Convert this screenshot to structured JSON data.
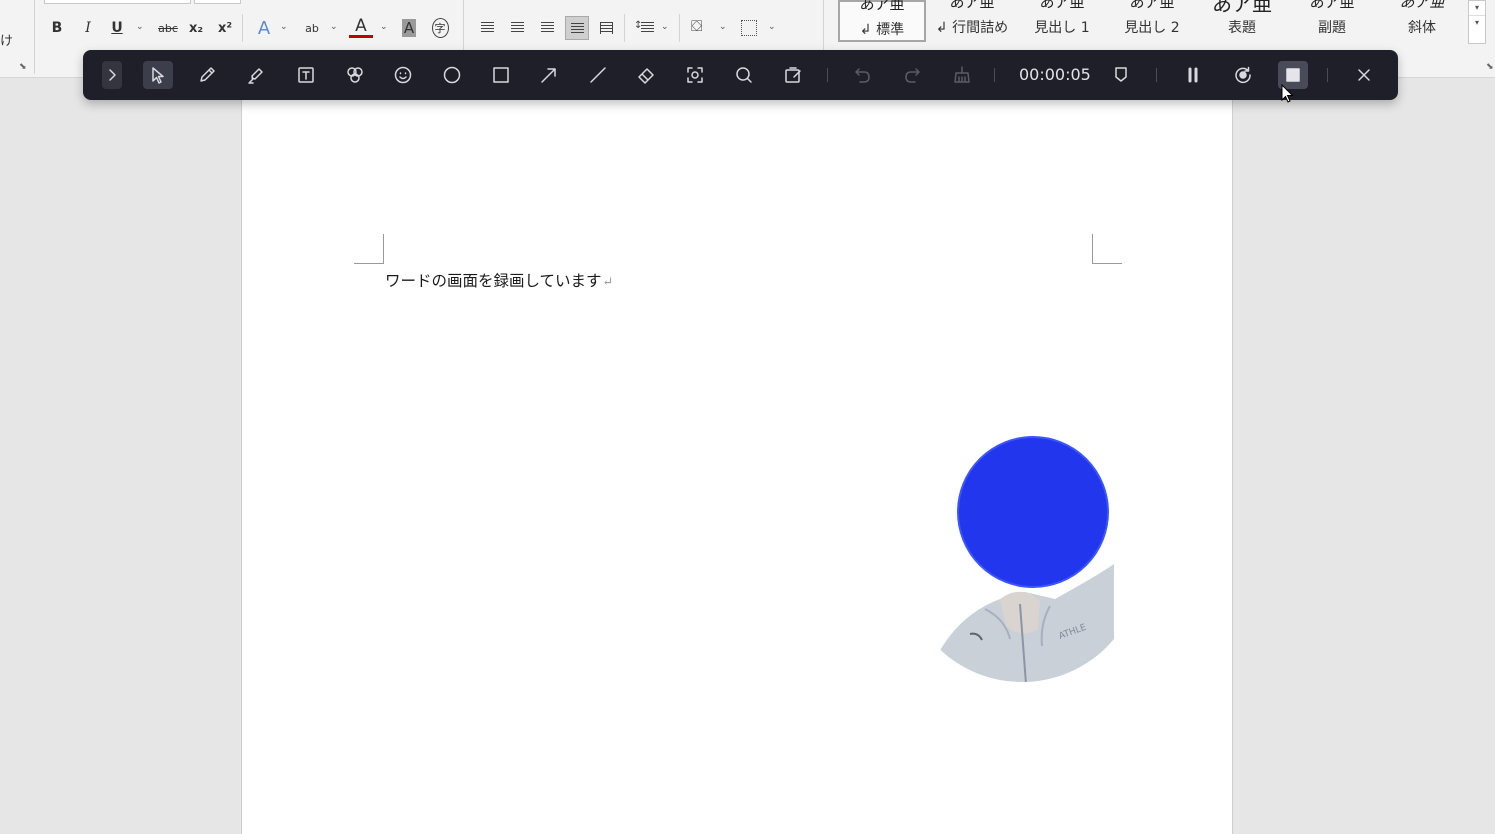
{
  "ribbon": {
    "cut_label": "け",
    "font_buttons": [
      {
        "name": "bold-button",
        "icon": "bold-icon",
        "glyph": "B"
      },
      {
        "name": "italic-button",
        "icon": "italic-icon",
        "glyph": "I"
      },
      {
        "name": "underline-button",
        "icon": "underline-icon",
        "glyph": "U"
      },
      {
        "name": "strikethrough-button",
        "icon": "strikethrough-icon",
        "glyph": "abc"
      },
      {
        "name": "subscript-button",
        "icon": "subscript-icon",
        "glyph": "x₂"
      },
      {
        "name": "superscript-button",
        "icon": "superscript-icon",
        "glyph": "x²"
      },
      {
        "name": "text-effects-button",
        "icon": "text-effects-icon",
        "glyph": "A"
      },
      {
        "name": "highlight-button",
        "icon": "highlighter-icon",
        "glyph": "ab"
      },
      {
        "name": "font-color-button",
        "icon": "font-color-icon",
        "glyph": "A"
      },
      {
        "name": "char-shading-button",
        "icon": "char-shading-icon",
        "glyph": "A"
      },
      {
        "name": "enclose-char-button",
        "icon": "enclose-char-icon",
        "glyph": "字"
      }
    ],
    "font_color_hex": "#c00000",
    "styles_gallery": {
      "items": [
        {
          "preview": "あア亜",
          "label": "↲ 標準",
          "selected": true
        },
        {
          "preview": "あア亜",
          "label": "↲ 行間詰め",
          "selected": false
        },
        {
          "preview": "あア亜",
          "label": "見出し 1",
          "selected": false
        },
        {
          "preview": "あア亜",
          "label": "見出し 2",
          "selected": false
        },
        {
          "preview": "あア亜",
          "label": "表題",
          "selected": false
        },
        {
          "preview": "あア亜",
          "label": "副題",
          "selected": false
        },
        {
          "preview": "あア亜",
          "label": "斜体",
          "selected": false
        }
      ]
    }
  },
  "document": {
    "text": "ワードの画面を録画しています",
    "paragraph_mark": "↵"
  },
  "recorder": {
    "timer": "00:00:05",
    "tools": [
      {
        "name": "collapse-button",
        "icon": "chevron-right-icon"
      },
      {
        "name": "select-tool",
        "icon": "cursor-arrow-icon",
        "active": true
      },
      {
        "name": "pen-tool",
        "icon": "pencil-icon"
      },
      {
        "name": "highlighter-tool",
        "icon": "highlighter-icon"
      },
      {
        "name": "text-tool",
        "icon": "text-box-icon"
      },
      {
        "name": "numbered-marker-tool",
        "icon": "numbered-marker-icon"
      },
      {
        "name": "emoji-tool",
        "icon": "smiley-icon"
      },
      {
        "name": "ellipse-tool",
        "icon": "circle-icon"
      },
      {
        "name": "rectangle-tool",
        "icon": "square-icon"
      },
      {
        "name": "arrow-tool",
        "icon": "arrow-icon"
      },
      {
        "name": "line-tool",
        "icon": "line-icon"
      },
      {
        "name": "eraser-tool",
        "icon": "eraser-icon"
      },
      {
        "name": "spotlight-tool",
        "icon": "focus-icon"
      },
      {
        "name": "zoom-tool",
        "icon": "magnifier-icon"
      },
      {
        "name": "whiteboard-tool",
        "icon": "whiteboard-icon"
      },
      {
        "name": "undo-button",
        "icon": "undo-icon",
        "disabled": true
      },
      {
        "name": "redo-button",
        "icon": "redo-icon",
        "disabled": true
      },
      {
        "name": "clear-button",
        "icon": "broom-icon",
        "disabled": true
      },
      {
        "name": "mark-button",
        "icon": "flag-icon"
      },
      {
        "name": "pause-button",
        "icon": "pause-icon"
      },
      {
        "name": "restart-button",
        "icon": "restart-icon"
      },
      {
        "name": "stop-button",
        "icon": "stop-icon"
      },
      {
        "name": "close-button",
        "icon": "close-icon"
      }
    ]
  },
  "webcam": {
    "overlay_color": "#2236ee",
    "jacket_color": "#c9d0d8"
  }
}
